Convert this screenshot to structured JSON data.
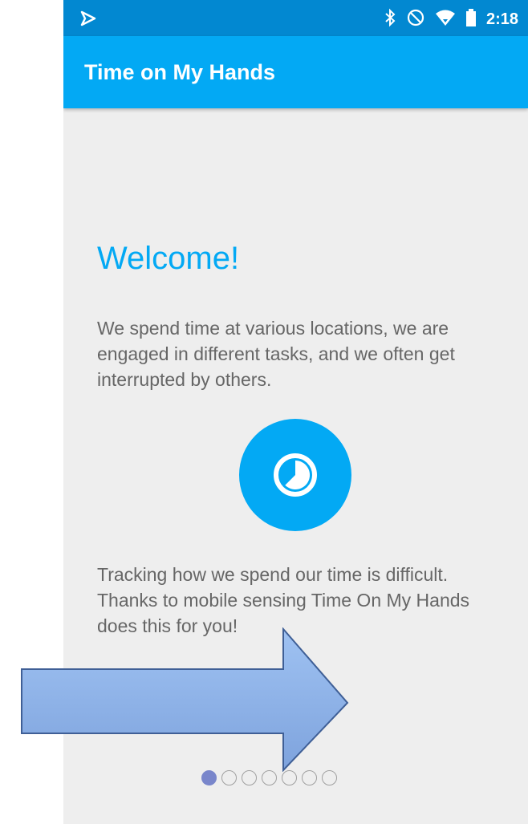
{
  "status_bar": {
    "time": "2:18",
    "icons": [
      "play-store-icon",
      "bluetooth-icon",
      "do-not-disturb-icon",
      "wifi-icon",
      "battery-icon"
    ]
  },
  "app_bar": {
    "title": "Time on My Hands"
  },
  "onboarding": {
    "heading": "Welcome!",
    "paragraph1": "We spend time at various locations, we are engaged in different tasks, and we often get interrupted by others.",
    "icon": "clock-icon",
    "paragraph2": "Tracking how we spend our time is difficult. Thanks to mobile sensing Time On My Hands does this for you!",
    "page_indicator": {
      "total_pages": 7,
      "current_page": 1
    }
  },
  "overlay": {
    "arrow": "right-arrow-icon",
    "color": "#8fb4e8"
  },
  "colors": {
    "status_bar": "#0288d1",
    "app_bar": "#03a9f4",
    "accent": "#03a9f4",
    "active_dot": "#7986cb"
  }
}
